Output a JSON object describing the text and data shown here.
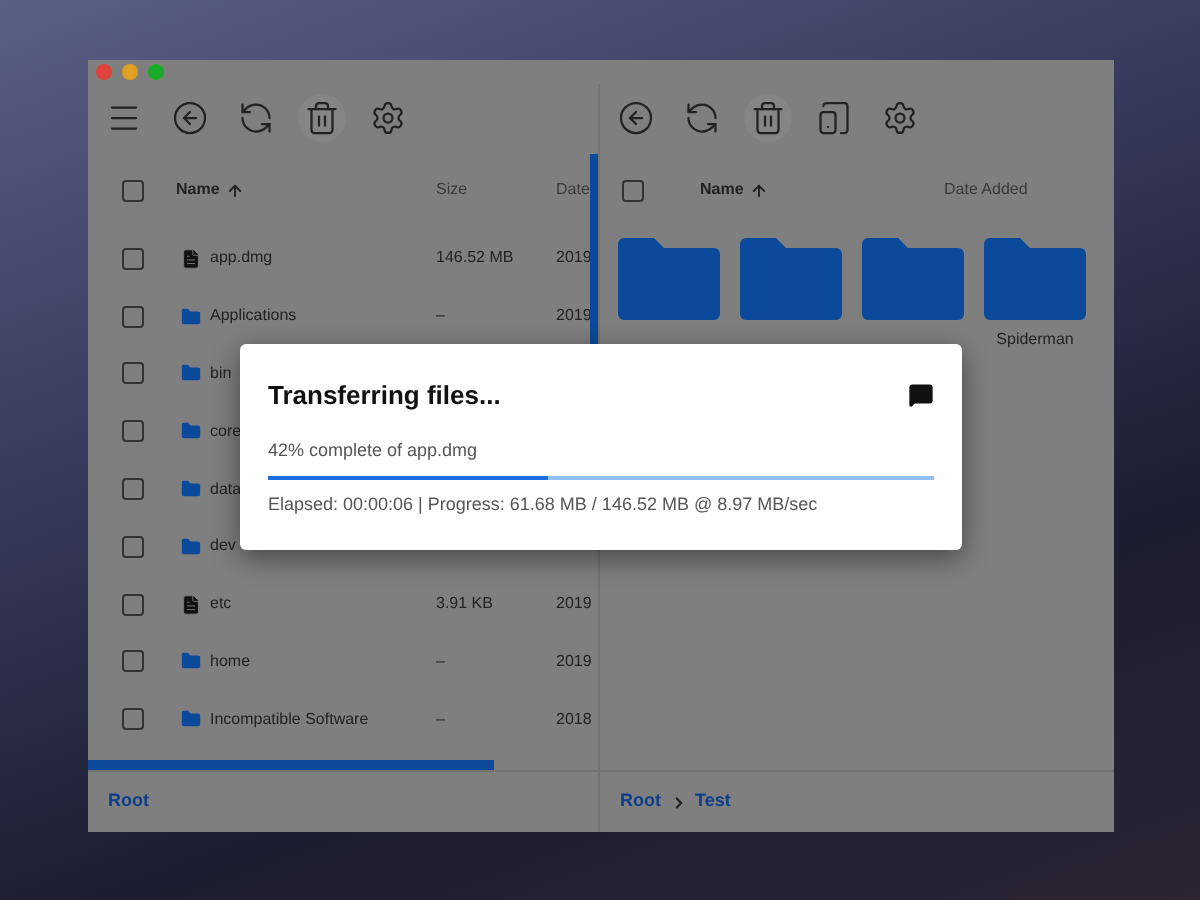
{
  "left_pane": {
    "select_all": {
      "checked": false
    },
    "columns": [
      "Name",
      "Size",
      "Date"
    ],
    "rows": [
      {
        "kind": "file",
        "name": "app.dmg",
        "size": "146.52 MB",
        "date": "2019",
        "checked": false
      },
      {
        "kind": "folder",
        "name": "Applications",
        "size": "–",
        "date": "2019",
        "checked": false
      },
      {
        "kind": "folder",
        "name": "bin",
        "checked": false
      },
      {
        "kind": "folder",
        "name": "core",
        "checked": false
      },
      {
        "kind": "folder",
        "name": "data",
        "checked": false
      },
      {
        "kind": "folder",
        "name": "dev",
        "checked": false
      },
      {
        "kind": "file",
        "name": "etc",
        "size": "3.91 KB",
        "date": "2019",
        "checked": false
      },
      {
        "kind": "folder",
        "name": "home",
        "size": "–",
        "date": "2019",
        "checked": false
      },
      {
        "kind": "folder",
        "name": "Incompatible Software",
        "size": "–",
        "date": "2018",
        "checked": false
      }
    ],
    "breadcrumb": [
      "Root"
    ]
  },
  "right_pane": {
    "select_all": {
      "checked": false
    },
    "columns": [
      "Name",
      "Date Added"
    ],
    "folders": [
      {
        "kind": "folder"
      },
      {
        "kind": "folder"
      },
      {
        "kind": "folder"
      },
      {
        "kind": "folder",
        "label": "Spiderman"
      }
    ],
    "breadcrumb": [
      "Root",
      "Test"
    ]
  },
  "dialog": {
    "title": "Transferring files...",
    "progress_text": "42% complete of app.dmg",
    "level": 0.42,
    "status": "Elapsed: 00:00:06 | Progress: 61.68 MB / 146.52 MB @ 8.97 MB/sec"
  }
}
